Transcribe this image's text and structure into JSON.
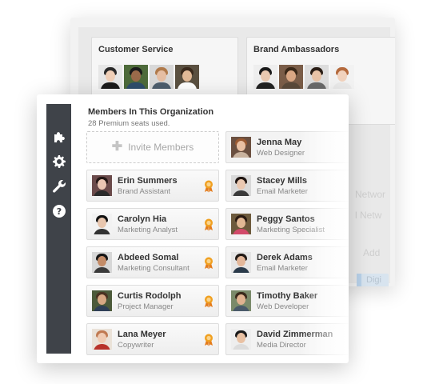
{
  "back_panel": {
    "groups": [
      {
        "title": "Customer Service",
        "avatars": [
          {
            "bg": "#e7e7e7",
            "skin": "#f0cfb7",
            "hair": "#2a2a2a",
            "shirt": "#1b1b1b"
          },
          {
            "bg": "#4d6a3a",
            "skin": "#9a6a4a",
            "hair": "#1b1b1b",
            "shirt": "#2e4d6b"
          },
          {
            "bg": "#d8d8d8",
            "skin": "#e5bea3",
            "hair": "#b07a4b",
            "shirt": "#4d5d6d"
          },
          {
            "bg": "#5a5040",
            "skin": "#e1b996",
            "hair": "#3b2a1c",
            "shirt": "#ffffff"
          }
        ]
      },
      {
        "title": "Brand Ambassadors",
        "avatars": [
          {
            "bg": "#eeeeee",
            "skin": "#e8c8b0",
            "hair": "#1a1a1a",
            "shirt": "#222222"
          },
          {
            "bg": "#7a5d48",
            "skin": "#d9a784",
            "hair": "#3a2818",
            "shirt": "#5a4a3a"
          },
          {
            "bg": "#dddddd",
            "skin": "#e8c3a6",
            "hair": "#2a1e16",
            "shirt": "#6a6a6a"
          },
          {
            "bg": "#f2f2f2",
            "skin": "#f1d2bd",
            "hair": "#b56a3d",
            "shirt": "#e9e9e9"
          }
        ]
      }
    ],
    "faded_labels": [
      "Networ",
      "l Netw",
      "Add",
      "Digi"
    ]
  },
  "sidebar": {
    "icons": [
      {
        "name": "puzzle-icon"
      },
      {
        "name": "gear-icon"
      },
      {
        "name": "wrench-icon"
      },
      {
        "name": "help-icon"
      }
    ]
  },
  "organization": {
    "title": "Members In This Organization",
    "subtitle": "28 Premium seats used.",
    "invite_label": "Invite Members",
    "invite_plus": "✚"
  },
  "members_left": [
    {
      "name": "Erin Summers",
      "role": "Brand Assistant",
      "badge": true,
      "avatar": {
        "bg": "#6a4a4a",
        "skin": "#eac6b3",
        "hair": "#231614",
        "shirt": "#2a2a2a"
      }
    },
    {
      "name": "Carolyn Hia",
      "role": "Marketing Analyst",
      "badge": true,
      "avatar": {
        "bg": "#f2f2f2",
        "skin": "#e8c6ae",
        "hair": "#111111",
        "shirt": "#333333"
      }
    },
    {
      "name": "Abdeed Somal",
      "role": "Marketing Consultant",
      "badge": true,
      "avatar": {
        "bg": "#d7d7d7",
        "skin": "#c48c68",
        "hair": "#151515",
        "shirt": "#3a3a3a"
      }
    },
    {
      "name": "Curtis Rodolph",
      "role": "Project Manager",
      "badge": true,
      "avatar": {
        "bg": "#4c5a3a",
        "skin": "#d8a884",
        "hair": "#4a3222",
        "shirt": "#2f3f57"
      }
    },
    {
      "name": "Lana Meyer",
      "role": "Copywriter",
      "badge": true,
      "avatar": {
        "bg": "#eae2d8",
        "skin": "#f0ccb4",
        "hair": "#c07a52",
        "shirt": "#b8322a"
      }
    }
  ],
  "members_right": [
    {
      "name": "Jenna May",
      "role": "Web Designer",
      "avatar": {
        "bg": "#6b5040",
        "skin": "#e9c0a2",
        "hair": "#9a5a32",
        "shirt": "#c9b39f"
      }
    },
    {
      "name": "Stacey Mills",
      "role": "Email Marketer",
      "avatar": {
        "bg": "#d9d9d9",
        "skin": "#eac8b1",
        "hair": "#1e1410",
        "shirt": "#3a3a3a"
      }
    },
    {
      "name": "Peggy Santos",
      "role": "Marketing Specialist",
      "avatar": {
        "bg": "#6d5a3c",
        "skin": "#e2b894",
        "hair": "#2a1a12",
        "shirt": "#d24a6a"
      }
    },
    {
      "name": "Derek Adams",
      "role": "Email Marketer",
      "avatar": {
        "bg": "#e5e5e5",
        "skin": "#e3b79a",
        "hair": "#221a16",
        "shirt": "#2a3a4a"
      }
    },
    {
      "name": "Timothy Baker",
      "role": "Web Developer",
      "avatar": {
        "bg": "#7a8a6a",
        "skin": "#e0b290",
        "hair": "#3a2a1c",
        "shirt": "#4a5a6a"
      }
    },
    {
      "name": "David Zimmerman",
      "role": "Media Director",
      "avatar": {
        "bg": "#eeeeee",
        "skin": "#e9c1a3",
        "hair": "#1a1a1a",
        "shirt": "#dcdcdc"
      }
    }
  ],
  "colors": {
    "sidebar": "#3f4349",
    "badge": "#f0a020",
    "badge_ribbon": "#e47c1c"
  }
}
